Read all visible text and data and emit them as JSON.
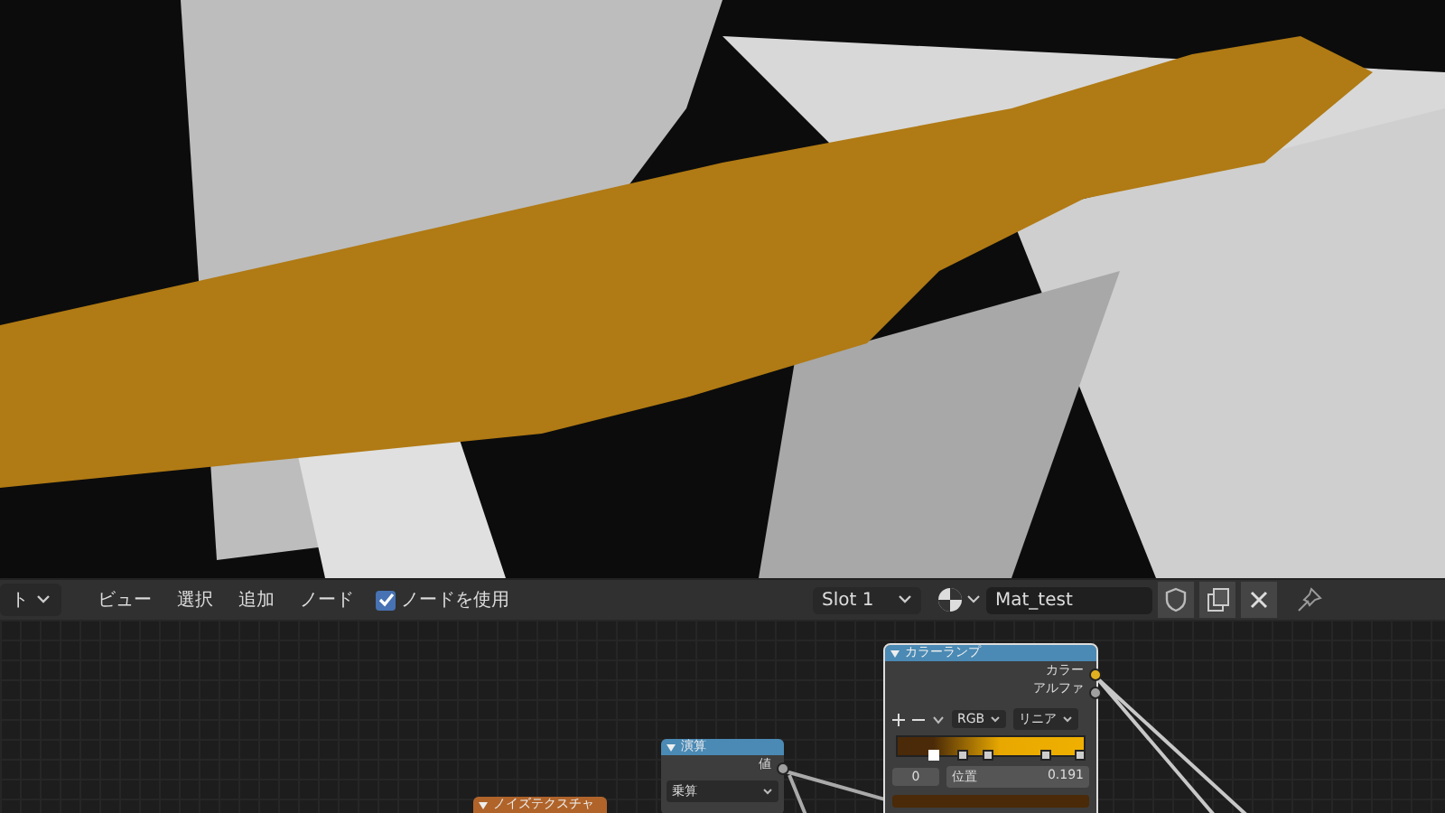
{
  "header": {
    "editor_menu": "ト",
    "menus": [
      "ビュー",
      "選択",
      "追加",
      "ノード"
    ],
    "use_nodes": {
      "label": "ノードを使用",
      "checked": true
    },
    "slot": "Slot 1",
    "material": "Mat_test"
  },
  "nodes": [
    {
      "kind": "color_ramp",
      "title": "カラーランプ",
      "outputs": [
        "カラー",
        "アルファ"
      ],
      "mode": "RGB",
      "interpolation": "リニア",
      "stops": [
        {
          "level": 0.19,
          "selected": true
        },
        {
          "level": 0.35,
          "selected": false
        },
        {
          "level": 0.49,
          "selected": false
        },
        {
          "level": 0.8,
          "selected": false
        },
        {
          "level": 0.98,
          "selected": false
        }
      ],
      "index": "0",
      "position_label": "位置",
      "position_value": "0.191"
    },
    {
      "kind": "math",
      "title": "演算",
      "output": "値",
      "operation": "乗算"
    },
    {
      "kind": "texture",
      "title": "ノイズテクスチャ"
    }
  ]
}
